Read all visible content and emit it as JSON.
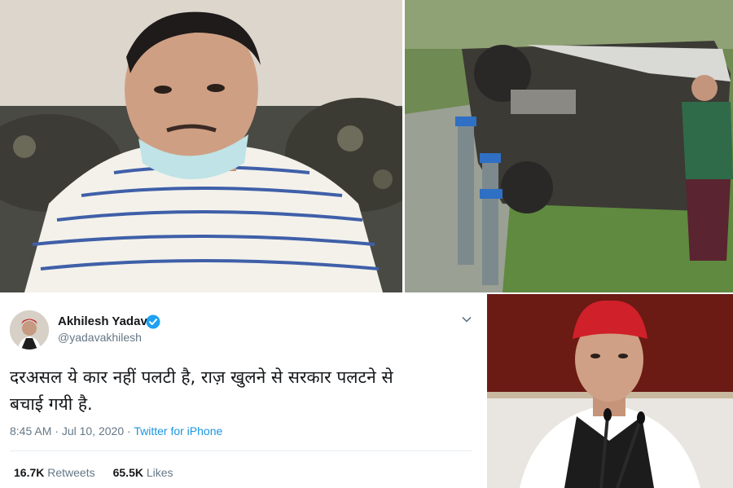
{
  "tweet": {
    "author_name": "Akhilesh Yadav",
    "handle": "@yadavakhilesh",
    "text_line_1": "दरअसल ये कार नहीं पलटी है, राज़ खुलने से सरकार पलटने से",
    "text_line_2": "बचाई गयी है.",
    "time": "8:45 AM",
    "date": "Jul 10, 2020",
    "source": "Twitter for iPhone",
    "retweets_count": "16.7K",
    "retweets_label": "Retweets",
    "likes_count": "65.5K",
    "likes_label": "Likes"
  },
  "icons": {
    "verified": "verified-badge-icon",
    "more": "chevron-down-icon"
  },
  "colors": {
    "link": "#1b95e0",
    "verified": "#1da1f2",
    "muted": "#657786"
  }
}
